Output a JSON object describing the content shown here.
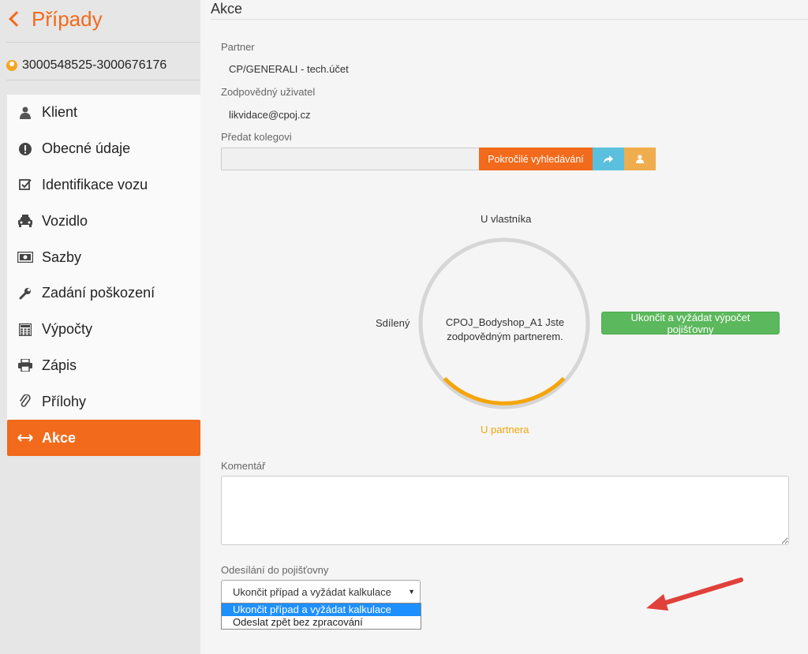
{
  "header": {
    "back_label": "Případy"
  },
  "case": {
    "id": "3000548525-3000676176"
  },
  "sidebar": {
    "items": [
      {
        "label": "Klient",
        "icon": "user-icon"
      },
      {
        "label": "Obecné údaje",
        "icon": "exclamation-circle-icon"
      },
      {
        "label": "Identifikace vozu",
        "icon": "checkbox-icon"
      },
      {
        "label": "Vozidlo",
        "icon": "car-icon"
      },
      {
        "label": "Sazby",
        "icon": "money-icon"
      },
      {
        "label": "Zadání poškození",
        "icon": "wrench-icon"
      },
      {
        "label": "Výpočty",
        "icon": "calculator-icon"
      },
      {
        "label": "Zápis",
        "icon": "printer-icon"
      },
      {
        "label": "Přílohy",
        "icon": "paperclip-icon"
      },
      {
        "label": "Akce",
        "icon": "arrows-horizontal-icon"
      }
    ],
    "active": "Akce"
  },
  "main": {
    "title": "Akce",
    "partner_label": "Partner",
    "partner_value": "CP/GENERALI - tech.účet",
    "responsible_label": "Zodpovědný uživatel",
    "responsible_value": "likvidace@cpoj.cz",
    "handover_label": "Předat kolegovi",
    "handover_value": "",
    "advanced_search_label": "Pokročilé vyhledávání",
    "ring": {
      "top_label": "U vlastníka",
      "left_label": "Sdílený",
      "bottom_label": "U partnera",
      "center_text": "CPOJ_Bodyshop_A1 Jste zodpovědným partnerem.",
      "active_state": "U partnera"
    },
    "finish_button_label": "Ukončit a vyžádat výpočet pojišťovny",
    "comment_label": "Komentář",
    "comment_value": "",
    "send_label": "Odesílání do pojišťovny",
    "send_selected": "Ukončit případ a vyžádat kalkulace",
    "send_options": [
      "Ukončit případ a vyžádat kalkulace",
      "Odeslat zpět bez zpracování"
    ]
  },
  "colors": {
    "accent": "#f26a1b",
    "success": "#5cb85c",
    "info": "#5bc0de",
    "warning": "#f0ad4e",
    "ring_active": "#f5a50a",
    "annotation_arrow": "#e0413b"
  }
}
